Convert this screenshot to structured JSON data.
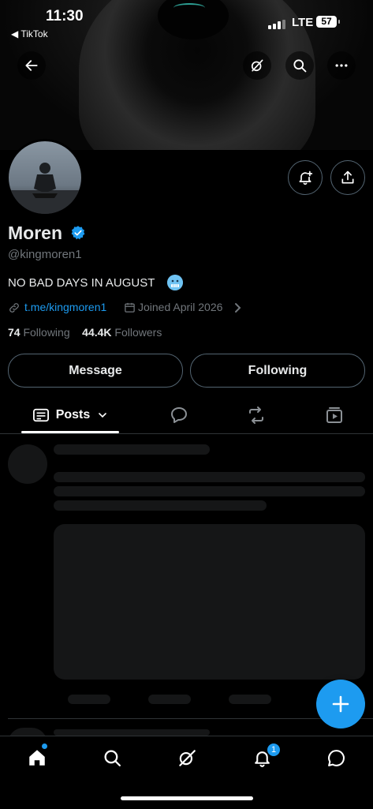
{
  "status_bar": {
    "time": "11:30",
    "back_app": "◀ TikTok",
    "network": "LTE",
    "battery": "57"
  },
  "profile": {
    "name": "Moren",
    "handle": "@kingmoren1",
    "bio": "NO BAD DAYS IN AUGUST",
    "link": "t.me/kingmoren1",
    "joined": "Joined April 2026",
    "following_count": "74",
    "following_label": "Following",
    "followers_count": "44.4K",
    "followers_label": "Followers"
  },
  "actions": {
    "message": "Message",
    "following": "Following"
  },
  "tabs": {
    "posts": "Posts"
  },
  "nav": {
    "notifications_badge": "1"
  },
  "colors": {
    "accent": "#1d9bf0",
    "background": "#000000",
    "muted": "#71767b"
  }
}
